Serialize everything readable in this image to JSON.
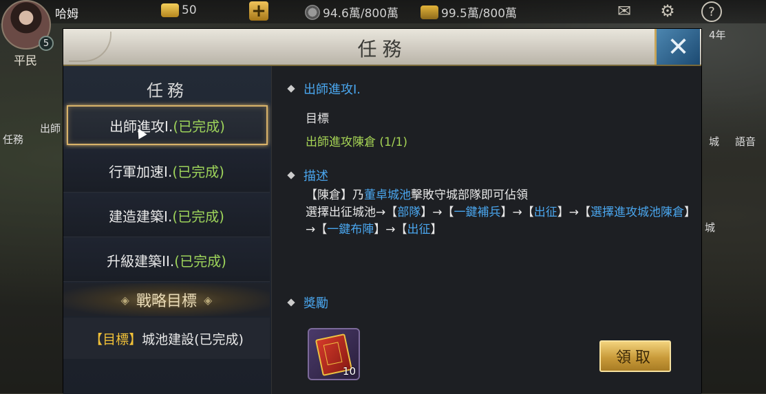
{
  "player": {
    "name": "哈姆",
    "level": "5",
    "rank": "平民"
  },
  "resources": {
    "gold": "50",
    "coin": "94.6萬/800萬",
    "grain": "99.5萬/800萬"
  },
  "top_icons": {
    "mail": "mail-icon",
    "settings": "gear-icon",
    "help": "?"
  },
  "behind": {
    "task_label": "任務",
    "task_text": "出師",
    "year_text": "4年",
    "right_a": "城",
    "right_b": "語音",
    "right_c": "城"
  },
  "modal": {
    "title": "任務",
    "close": "✕",
    "left_title": "任務",
    "quests": [
      {
        "name": "出師進攻I.",
        "status": "(已完成)",
        "selected": true
      },
      {
        "name": "行軍加速I.",
        "status": "(已完成)"
      },
      {
        "name": "建造建築I.",
        "status": "(已完成)"
      },
      {
        "name": "升級建築II.",
        "status": "(已完成)"
      }
    ],
    "strategy_header": "戰略目標",
    "goal": {
      "prefix": "【目標】",
      "name": "城池建設",
      "status": "(已完成)"
    },
    "detail": {
      "quest_name": "出師進攻I.",
      "objective_label": "目標",
      "objective_text": "出師進攻陳倉 (1/1)",
      "desc_label": "描述",
      "desc": {
        "p1": "【陳倉】乃",
        "p1_hl": "董卓城池",
        "p1b": "擊敗守城部隊即可佔領",
        "p2a": "選擇出征城池→【",
        "p2_hl1": "部隊",
        "p2b": "】→【",
        "p2_hl2": "一鍵補兵",
        "p2c": "】→【",
        "p2_hl3": "出征",
        "p2d": "】→【",
        "p2_hl4": "選擇進攻城池陳倉",
        "p2e": "】→【",
        "p2_hl5": "一鍵布陣",
        "p2f": "】→【",
        "p2_hl6": "出征",
        "p2g": "】"
      },
      "reward_label": "獎勵",
      "reward_count": "10",
      "claim_label": "領取"
    }
  },
  "colors": {
    "accent_blue": "#4aa6ee",
    "done_green": "#9dd35a",
    "gold": "#d9b36a"
  }
}
